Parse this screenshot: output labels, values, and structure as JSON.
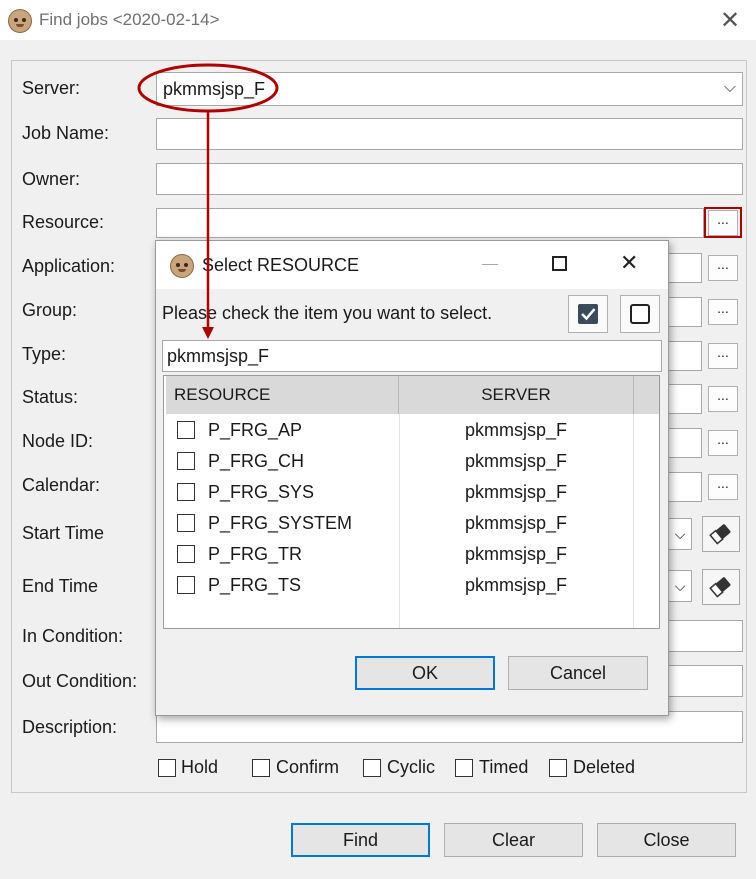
{
  "window": {
    "title": "Find jobs <2020-02-14>"
  },
  "form": {
    "server_label": "Server:",
    "server_value": "pkmmsjsp_F",
    "job_name_label": "Job Name:",
    "owner_label": "Owner:",
    "resource_label": "Resource:",
    "application_label": "Application:",
    "group_label": "Group:",
    "type_label": "Type:",
    "status_label": "Status:",
    "node_id_label": "Node ID:",
    "calendar_label": "Calendar:",
    "start_time_label": "Start Time",
    "end_time_label": "End Time",
    "in_condition_label": "In Condition:",
    "out_condition_label": "Out Condition:",
    "description_label": "Description:",
    "browse_label": "..."
  },
  "checkboxes": [
    "Hold",
    "Confirm",
    "Cyclic",
    "Timed",
    "Deleted"
  ],
  "buttons": {
    "find": "Find",
    "clear": "Clear",
    "close": "Close"
  },
  "dialog": {
    "title": "Select RESOURCE",
    "instruction": "Please check the item you want to select.",
    "filter_value": "pkmmsjsp_F",
    "columns": [
      "RESOURCE",
      "SERVER"
    ],
    "rows": [
      {
        "resource": "P_FRG_AP",
        "server": "pkmmsjsp_F"
      },
      {
        "resource": "P_FRG_CH",
        "server": "pkmmsjsp_F"
      },
      {
        "resource": "P_FRG_SYS",
        "server": "pkmmsjsp_F"
      },
      {
        "resource": "P_FRG_SYSTEM",
        "server": "pkmmsjsp_F"
      },
      {
        "resource": "P_FRG_TR",
        "server": "pkmmsjsp_F"
      },
      {
        "resource": "P_FRG_TS",
        "server": "pkmmsjsp_F"
      }
    ],
    "ok": "OK",
    "cancel": "Cancel"
  },
  "colors": {
    "annotation": "#b00000",
    "focus": "#0078d7"
  }
}
